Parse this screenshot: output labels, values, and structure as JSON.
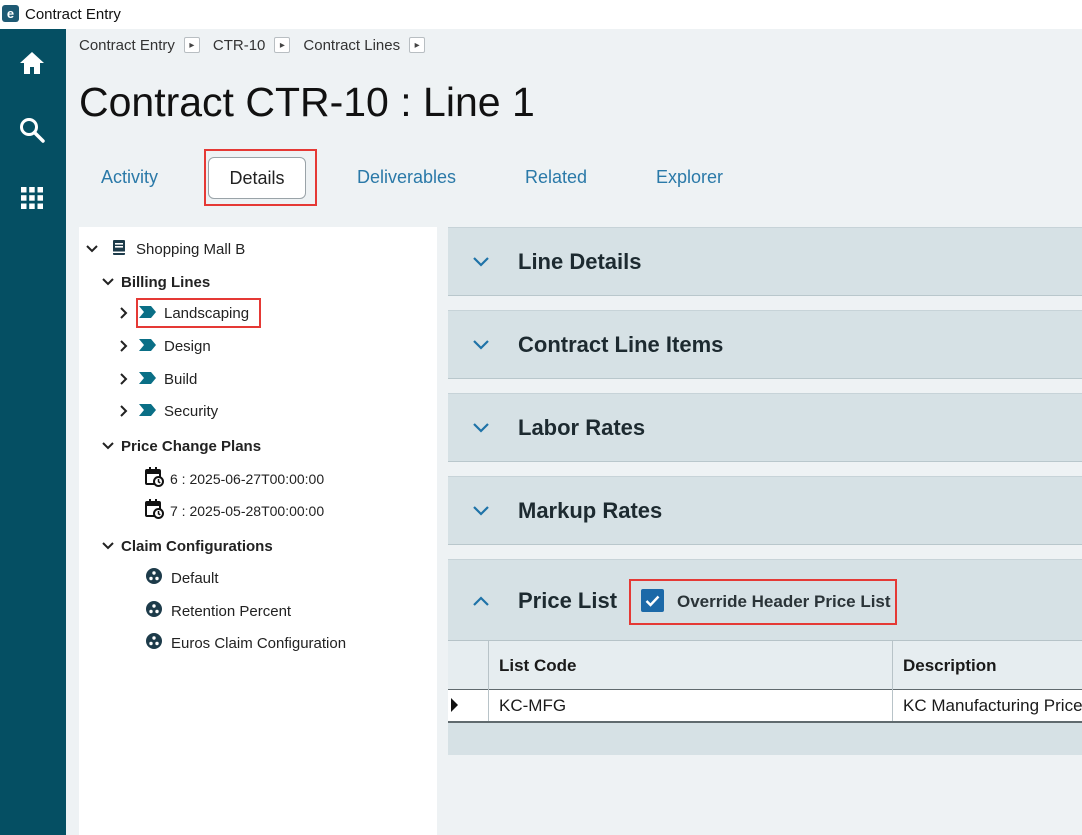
{
  "app": {
    "title": "Contract Entry",
    "logo_letter": "e"
  },
  "nav": {
    "items": [
      "home-icon",
      "search-icon",
      "apps-grid-icon"
    ]
  },
  "breadcrumb": [
    "Contract Entry",
    "CTR-10",
    "Contract Lines"
  ],
  "page_title": "Contract CTR-10 : Line 1",
  "tabs": {
    "activity": "Activity",
    "details": "Details",
    "deliverables": "Deliverables",
    "related": "Related",
    "explorer": "Explorer",
    "active": "Details"
  },
  "tree": {
    "root": "Shopping Mall B",
    "billing_lines_label": "Billing Lines",
    "billing_lines": [
      "Landscaping",
      "Design",
      "Build",
      "Security"
    ],
    "price_change_plans_label": "Price Change Plans",
    "price_change_plans": [
      "6 : 2025-06-27T00:00:00",
      "7 : 2025-05-28T00:00:00"
    ],
    "claim_configurations_label": "Claim Configurations",
    "claim_configurations": [
      "Default",
      "Retention Percent",
      "Euros Claim Configuration"
    ]
  },
  "sections": {
    "line_details": "Line Details",
    "contract_line_items": "Contract Line Items",
    "labor_rates": "Labor Rates",
    "markup_rates": "Markup Rates",
    "price_list": "Price List"
  },
  "price_list": {
    "override_label": "Override Header Price List",
    "override_checked": true,
    "columns": [
      "List Code",
      "Description"
    ],
    "rows": [
      {
        "list_code": "KC-MFG",
        "description": "KC Manufacturing Price"
      }
    ]
  },
  "colors": {
    "nav_bg": "#054f63",
    "accent_blue": "#2a79a8",
    "highlight_red": "#e53935",
    "section_bg": "#d6e1e5",
    "checkbox_blue": "#1c69a8"
  }
}
